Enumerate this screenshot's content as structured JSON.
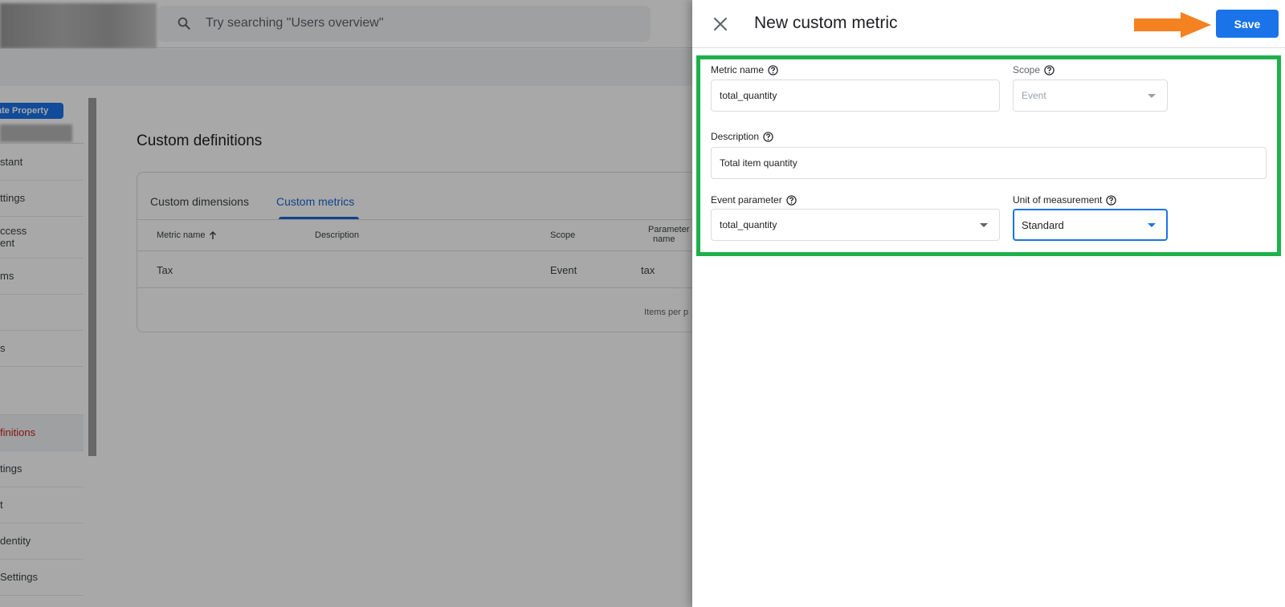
{
  "search": {
    "placeholder": "Try searching \"Users overview\""
  },
  "sidebar": {
    "badge": "ate Property",
    "items": [
      {
        "label": "stant"
      },
      {
        "label": "ttings"
      },
      {
        "label": "ccess",
        "label2": "ent"
      },
      {
        "label": "ms"
      },
      {
        "label": ""
      },
      {
        "label": "s"
      },
      {
        "label": ""
      },
      {
        "label": "finitions"
      },
      {
        "label": "tings"
      },
      {
        "label": "t"
      },
      {
        "label": "dentity"
      },
      {
        "label": " Settings"
      }
    ]
  },
  "main": {
    "title": "Custom definitions",
    "tabs": [
      {
        "label": "Custom dimensions"
      },
      {
        "label": "Custom metrics"
      }
    ],
    "table": {
      "headers": {
        "metric_name": "Metric name",
        "description": "Description",
        "scope": "Scope",
        "parameter_1": "Parameter",
        "parameter_2": "name"
      },
      "rows": [
        {
          "metric_name": "Tax",
          "description": "",
          "scope": "Event",
          "parameter": "tax"
        }
      ],
      "footer": "Items per p"
    }
  },
  "drawer": {
    "title": "New custom metric",
    "save_label": "Save",
    "fields": {
      "metric_name": {
        "label": "Metric name",
        "value": "total_quantity"
      },
      "scope": {
        "label": "Scope",
        "value": "Event"
      },
      "description": {
        "label": "Description",
        "value": "Total item quantity"
      },
      "event_parameter": {
        "label": "Event parameter",
        "value": "total_quantity"
      },
      "unit": {
        "label": "Unit of measurement",
        "value": "Standard"
      }
    }
  },
  "colors": {
    "accent": "#1a73e8",
    "highlight": "#1db14b",
    "arrow": "#f58220",
    "active_nav": "#c5221f"
  }
}
